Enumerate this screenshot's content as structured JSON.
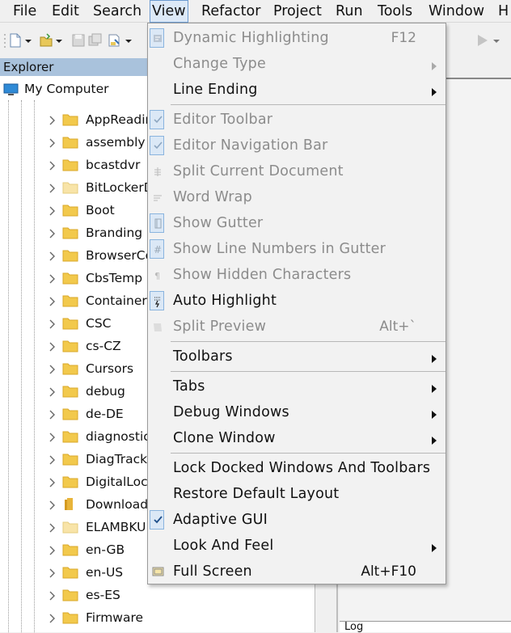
{
  "menubar": {
    "items": [
      "File",
      "Edit",
      "Search",
      "View",
      "Refactor",
      "Project",
      "Run",
      "Tools",
      "Window",
      "H"
    ],
    "active": "View"
  },
  "explorer": {
    "title": "Explorer",
    "root": "My Computer",
    "folders": [
      "AppReadin",
      "assembly",
      "bcastdvr",
      "BitLockerD",
      "Boot",
      "Branding",
      "BrowserCo",
      "CbsTemp",
      "Containers",
      "CSC",
      "cs-CZ",
      "Cursors",
      "debug",
      "de-DE",
      "diagnostic",
      "DiagTrack",
      "DigitalLoc",
      "Download",
      "ELAMBKU",
      "en-GB",
      "en-US",
      "es-ES",
      "Firmware"
    ]
  },
  "log": {
    "label": "Log"
  },
  "view_menu": {
    "dynamic_highlighting": {
      "label": "Dynamic Highlighting",
      "shortcut": "F12"
    },
    "change_type": {
      "label": "Change Type"
    },
    "line_ending": {
      "label": "Line Ending"
    },
    "editor_toolbar": {
      "label": "Editor Toolbar"
    },
    "editor_navigation_bar": {
      "label": "Editor Navigation Bar"
    },
    "split_current_document": {
      "label": "Split Current Document"
    },
    "word_wrap": {
      "label": "Word Wrap"
    },
    "show_gutter": {
      "label": "Show Gutter"
    },
    "show_line_numbers": {
      "label": "Show Line Numbers in Gutter"
    },
    "show_hidden_characters": {
      "label": "Show Hidden Characters"
    },
    "auto_highlight": {
      "label": "Auto Highlight"
    },
    "split_preview": {
      "label": "Split Preview",
      "shortcut": "Alt+`"
    },
    "toolbars": {
      "label": "Toolbars"
    },
    "tabs": {
      "label": "Tabs"
    },
    "debug_windows": {
      "label": "Debug Windows"
    },
    "clone_window": {
      "label": "Clone Window"
    },
    "lock_docked": {
      "label": "Lock Docked Windows And Toolbars"
    },
    "restore_layout": {
      "label": "Restore Default Layout"
    },
    "adaptive_gui": {
      "label": "Adaptive GUI"
    },
    "look_and_feel": {
      "label": "Look And Feel"
    },
    "full_screen": {
      "label": "Full Screen",
      "shortcut": "Alt+F10"
    }
  }
}
